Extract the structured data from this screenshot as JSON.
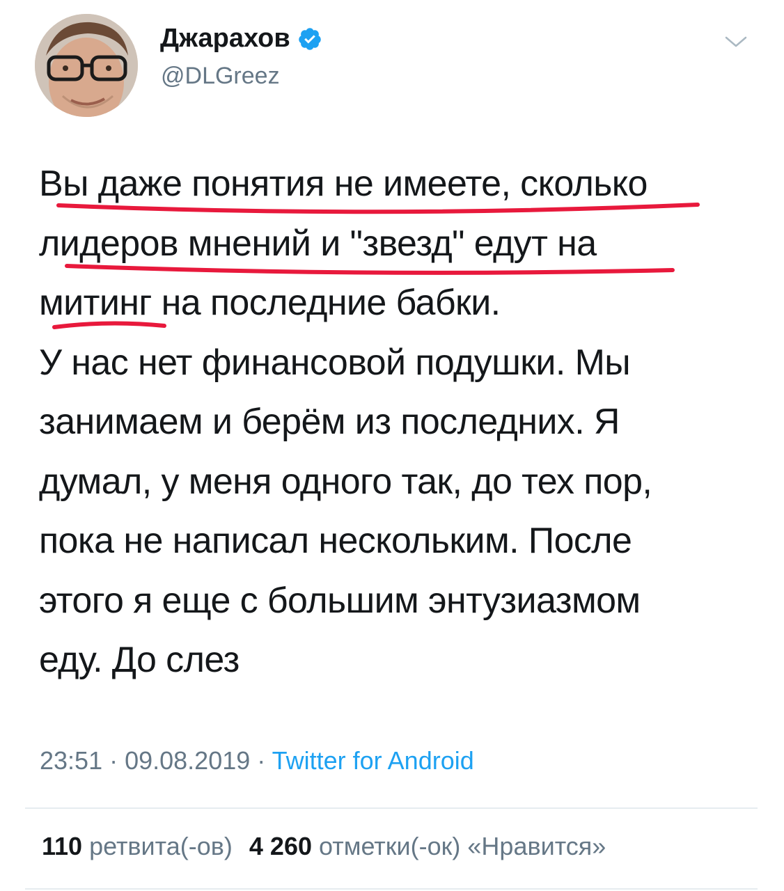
{
  "author": {
    "name": "Джарахов",
    "handle": "@DLGreez",
    "verified": true,
    "avatar": "profile-photo"
  },
  "tweet": {
    "lines": [
      "Вы даже понятия не имеете, сколько",
      "лидеров мнений и \"звезд\" едут на",
      "митинг на последние бабки.",
      "У нас нет финансовой подушки. Мы",
      "занимаем и берём из последних. Я",
      "думал, у меня одного так, до тех пор,",
      "пока не написал нескольким. После",
      "этого я еще с большим энтузиазмом",
      "еду. До слез"
    ],
    "underline_color": "#e8193c"
  },
  "meta": {
    "time": "23:51",
    "separator": " · ",
    "date": "09.08.2019",
    "source": "Twitter for Android"
  },
  "stats": {
    "retweets_count": "110",
    "retweets_label": "ретвита(-ов)",
    "likes_count": "4 260",
    "likes_label": "отметки(-ок) «Нравится»"
  },
  "colors": {
    "text": "#14171a",
    "secondary": "#657786",
    "link": "#1da1f2",
    "verified": "#1da1f2"
  },
  "icons": {
    "verified": "verified-badge-icon",
    "more": "chevron-down-icon"
  }
}
